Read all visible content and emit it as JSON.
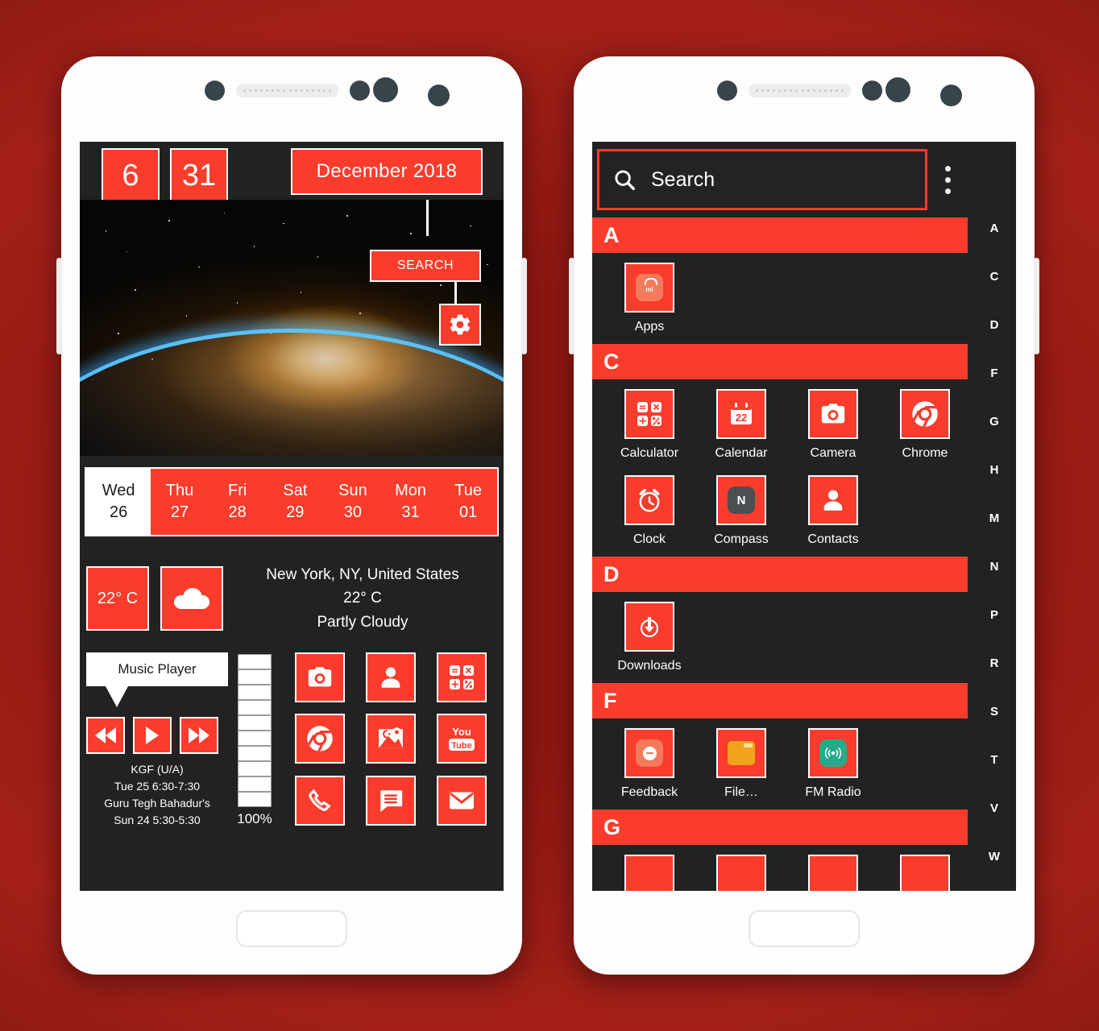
{
  "theme": {
    "accent": "#fa3c2c",
    "screen_bg": "#222222",
    "page_bg": "#a32019",
    "tile_border": "#ffffff"
  },
  "home": {
    "clock": {
      "hour": "6",
      "minute": "31"
    },
    "month_year": "December  2018",
    "search_label": "SEARCH",
    "settings_icon": "gear-icon",
    "calendar": [
      {
        "weekday": "Wed",
        "date": "26",
        "today": true
      },
      {
        "weekday": "Thu",
        "date": "27",
        "today": false
      },
      {
        "weekday": "Fri",
        "date": "28",
        "today": false
      },
      {
        "weekday": "Sat",
        "date": "29",
        "today": false
      },
      {
        "weekday": "Sun",
        "date": "30",
        "today": false
      },
      {
        "weekday": "Mon",
        "date": "31",
        "today": false
      },
      {
        "weekday": "Tue",
        "date": "01",
        "today": false
      }
    ],
    "weather": {
      "temp_tile": "22° C",
      "icon": "cloud-icon",
      "location": "New York, NY, United States",
      "temperature": "22° C",
      "condition": "Partly Cloudy"
    },
    "music": {
      "title": "Music Player",
      "prev_icon": "rewind-icon",
      "play_icon": "play-icon",
      "next_icon": "fast-forward-icon",
      "events": [
        "KGF (U/A)",
        "Tue 25 6:30-7:30",
        "Guru Tegh Bahadur's",
        "Sun 24 5:30-5:30"
      ]
    },
    "volume": {
      "percent": "100%",
      "segments": 10,
      "filled": 10
    },
    "dock_apps": [
      {
        "name": "Camera",
        "icon": "camera-icon"
      },
      {
        "name": "Contacts",
        "icon": "person-icon"
      },
      {
        "name": "Calculator",
        "icon": "calculator-icon"
      },
      {
        "name": "Chrome",
        "icon": "chrome-icon"
      },
      {
        "name": "Maps",
        "icon": "google-maps-icon"
      },
      {
        "name": "YouTube",
        "icon": "youtube-icon"
      },
      {
        "name": "Phone",
        "icon": "phone-icon"
      },
      {
        "name": "Messages",
        "icon": "message-icon"
      },
      {
        "name": "Email",
        "icon": "envelope-icon"
      }
    ]
  },
  "drawer": {
    "search": {
      "placeholder": "Search",
      "value": "",
      "icon": "search-icon"
    },
    "overflow_icon": "kebab-menu-icon",
    "sections": [
      {
        "letter": "A",
        "apps": [
          {
            "label": "Apps",
            "icon": "mi-store-icon"
          }
        ]
      },
      {
        "letter": "C",
        "apps": [
          {
            "label": "Calculator",
            "icon": "calculator-icon"
          },
          {
            "label": "Calendar",
            "icon": "calendar-icon"
          },
          {
            "label": "Camera",
            "icon": "camera-icon"
          },
          {
            "label": "Chrome",
            "icon": "chrome-icon"
          },
          {
            "label": "Clock",
            "icon": "alarm-clock-icon"
          },
          {
            "label": "Compass",
            "icon": "compass-icon"
          },
          {
            "label": "Contacts",
            "icon": "person-icon"
          }
        ]
      },
      {
        "letter": "D",
        "apps": [
          {
            "label": "Downloads",
            "icon": "download-icon"
          }
        ]
      },
      {
        "letter": "F",
        "apps": [
          {
            "label": "Feedback",
            "icon": "feedback-icon"
          },
          {
            "label": "File…",
            "icon": "folder-icon"
          },
          {
            "label": "FM Radio",
            "icon": "fm-radio-icon"
          }
        ]
      },
      {
        "letter": "G",
        "apps": []
      }
    ],
    "alpha_index": [
      "A",
      "C",
      "D",
      "F",
      "G",
      "H",
      "M",
      "N",
      "P",
      "R",
      "S",
      "T",
      "V",
      "W"
    ]
  }
}
